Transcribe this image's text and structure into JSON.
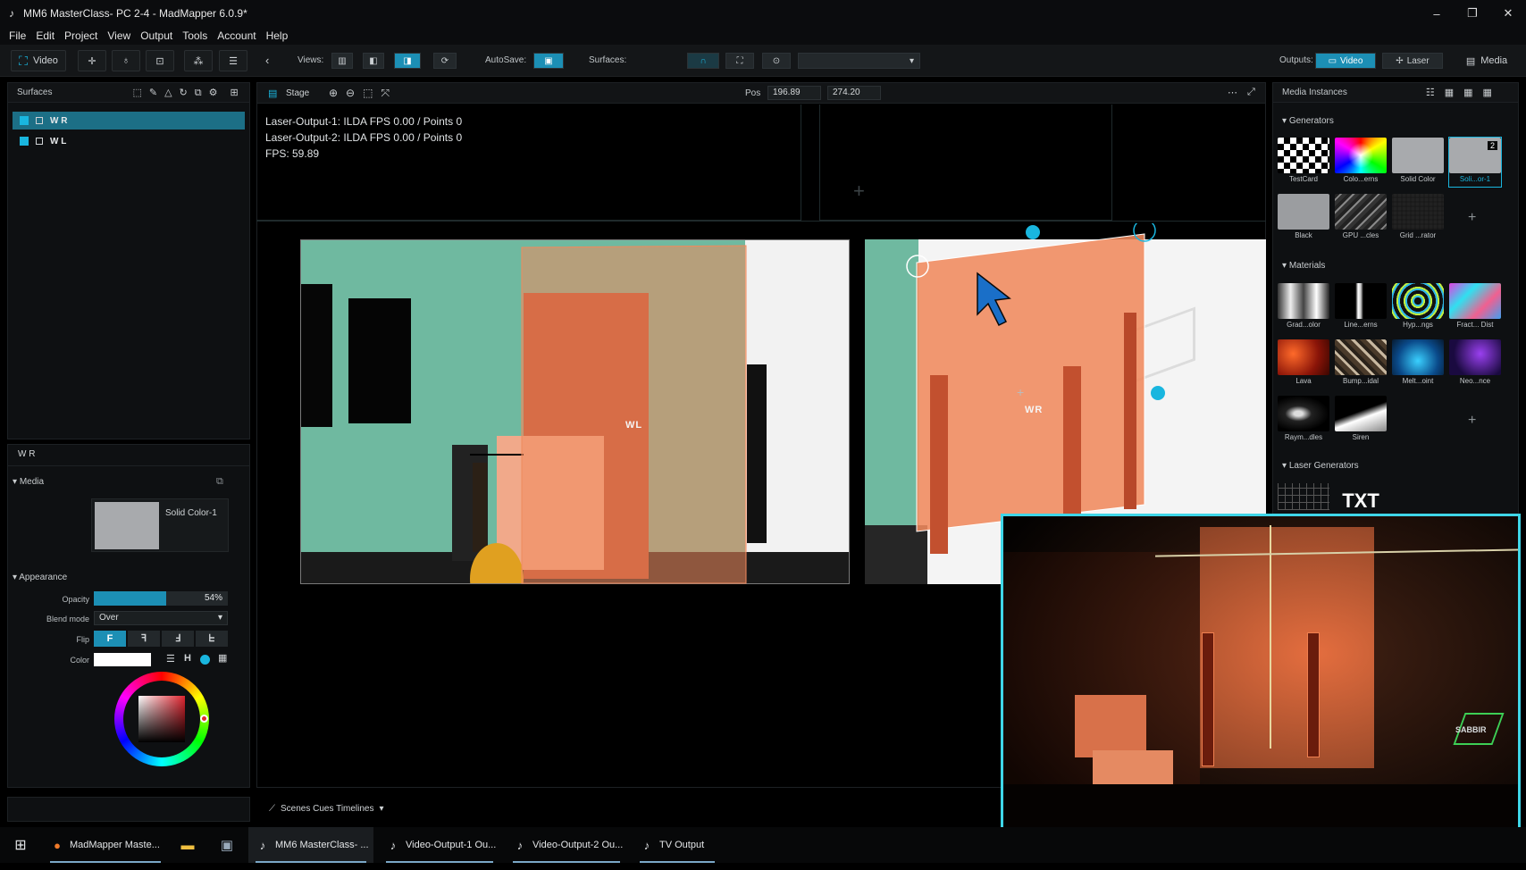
{
  "window": {
    "title": "MM6 MasterClass- PC 2-4 - MadMapper 6.0.9*",
    "min": "–",
    "max": "❐",
    "close": "✕"
  },
  "menu": [
    "File",
    "Edit",
    "Project",
    "View",
    "Output",
    "Tools",
    "Account",
    "Help"
  ],
  "toolbar": {
    "video_label": "Video",
    "views_label": "Views:",
    "autosave_label": "AutoSave:",
    "surfaces_label": "Surfaces:",
    "outputs_label": "Outputs:",
    "output_video": "Video",
    "output_laser": "Laser",
    "media_label": "Media"
  },
  "surfaces": {
    "header": "Surfaces",
    "items": [
      {
        "label": "W R",
        "selected": true
      },
      {
        "label": "W L",
        "selected": false
      }
    ]
  },
  "inspector": {
    "title": "W R",
    "media_section": "Media",
    "media_name": "Solid Color-1",
    "appearance_section": "Appearance",
    "opacity_label": "Opacity",
    "opacity_value": "54%",
    "opacity_fraction": 0.54,
    "blend_label": "Blend mode",
    "blend_value": "Over",
    "flip_label": "Flip",
    "flip_options": [
      "F",
      "ꟻ",
      "Ⅎ",
      "ᖶ"
    ],
    "color_label": "Color",
    "color_mode_h": "H"
  },
  "stage": {
    "tab": "Stage",
    "pos_label": "Pos",
    "pos_x": "196.89",
    "pos_y": "274.20",
    "info": [
      "Laser-Output-1: ILDA FPS 0.00 / Points 0",
      "Laser-Output-2: ILDA FPS 0.00 / Points 0",
      "FPS: 59.89"
    ],
    "label_wl": "WL",
    "label_wr": "WR",
    "timeline_label": "Scenes Cues Timelines"
  },
  "media_instances": {
    "header": "Media Instances",
    "generators_label": "Generators",
    "generators": [
      "TestCard",
      "Colo...erns",
      "Solid Color",
      "Soli...or-1",
      "Black",
      "GPU ...cles",
      "Grid ...rator"
    ],
    "selected_badge": "2",
    "materials_label": "Materials",
    "materials": [
      "Grad...olor",
      "Line...erns",
      "Hyp...ngs",
      "Fract... Dist",
      "Lava",
      "Bump...idal",
      "Melt...oint",
      "Neo...nce",
      "Raym...dles",
      "Siren"
    ],
    "laser_label": "Laser Generators",
    "laser_txt": "TXT"
  },
  "overlay": {
    "logo": "SABBIR"
  },
  "taskbar": {
    "items": [
      {
        "label": "MadMapper Maste...",
        "icon": "firefox-icon"
      },
      {
        "label": "MM6 MasterClass- ...",
        "icon": "madmapper-icon"
      },
      {
        "label": "Video-Output-1 Ou...",
        "icon": "madmapper-icon"
      },
      {
        "label": "Video-Output-2 Ou...",
        "icon": "madmapper-icon"
      },
      {
        "label": "TV Output",
        "icon": "madmapper-icon"
      }
    ]
  },
  "colors": {
    "accent": "#1fa8d6",
    "surface_orange": "#f08a5d",
    "wall_green": "#6fb9a0",
    "overlay_border": "#3fd6e8"
  }
}
